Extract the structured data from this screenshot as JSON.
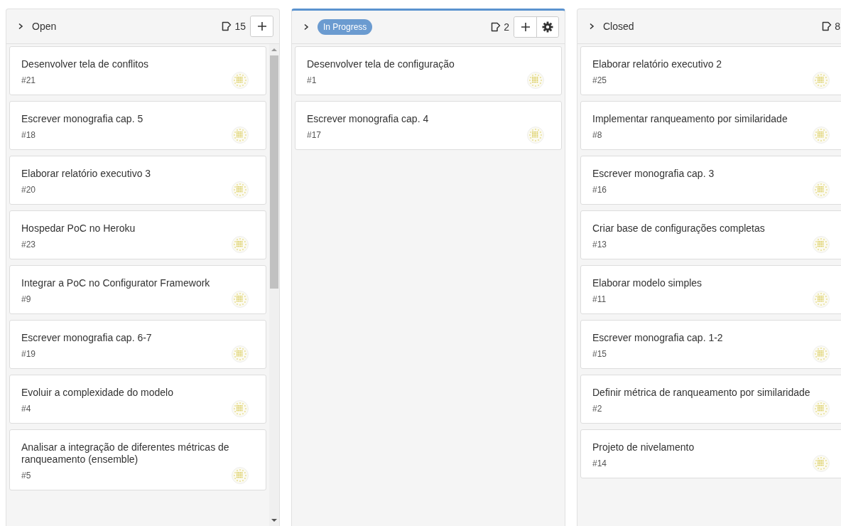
{
  "columns": [
    {
      "title": "Open",
      "highlighted": false,
      "count": "15",
      "actions": [
        {
          "kind": "add"
        }
      ],
      "scrollable": true,
      "cards": [
        {
          "title": "Desenvolver tela de conflitos",
          "number": "#21"
        },
        {
          "title": "Escrever monografia cap. 5",
          "number": "#18"
        },
        {
          "title": "Elaborar relatório executivo 3",
          "number": "#20"
        },
        {
          "title": "Hospedar PoC no Heroku",
          "number": "#23"
        },
        {
          "title": "Integrar a PoC no Configurator Framework",
          "number": "#9"
        },
        {
          "title": "Escrever monografia cap. 6-7",
          "number": "#19"
        },
        {
          "title": "Evoluir a complexidade do modelo",
          "number": "#4"
        },
        {
          "title": "Analisar a integração de diferentes métricas de ranqueamento (ensemble)",
          "number": "#5"
        }
      ]
    },
    {
      "title": "In Progress",
      "highlighted": true,
      "count": "2",
      "actions": [
        {
          "kind": "add"
        },
        {
          "kind": "settings"
        }
      ],
      "scrollable": false,
      "cards": [
        {
          "title": "Desenvolver tela de configuração",
          "number": "#1"
        },
        {
          "title": "Escrever monografia cap. 4",
          "number": "#17"
        }
      ]
    },
    {
      "title": "Closed",
      "highlighted": false,
      "count": "8",
      "scrollable": false,
      "cards": [
        {
          "title": "Elaborar relatório executivo 2",
          "number": "#25"
        },
        {
          "title": "Implementar ranqueamento por similaridade",
          "number": "#8"
        },
        {
          "title": "Escrever monografia cap. 3",
          "number": "#16"
        },
        {
          "title": "Criar base de configurações completas",
          "number": "#13"
        },
        {
          "title": "Elaborar modelo simples",
          "number": "#11"
        },
        {
          "title": "Escrever monografia cap. 1-2",
          "number": "#15"
        },
        {
          "title": "Definir métrica de ranqueamento por similaridade",
          "number": "#2"
        },
        {
          "title": "Projeto de nivelamento",
          "number": "#14"
        }
      ]
    }
  ]
}
